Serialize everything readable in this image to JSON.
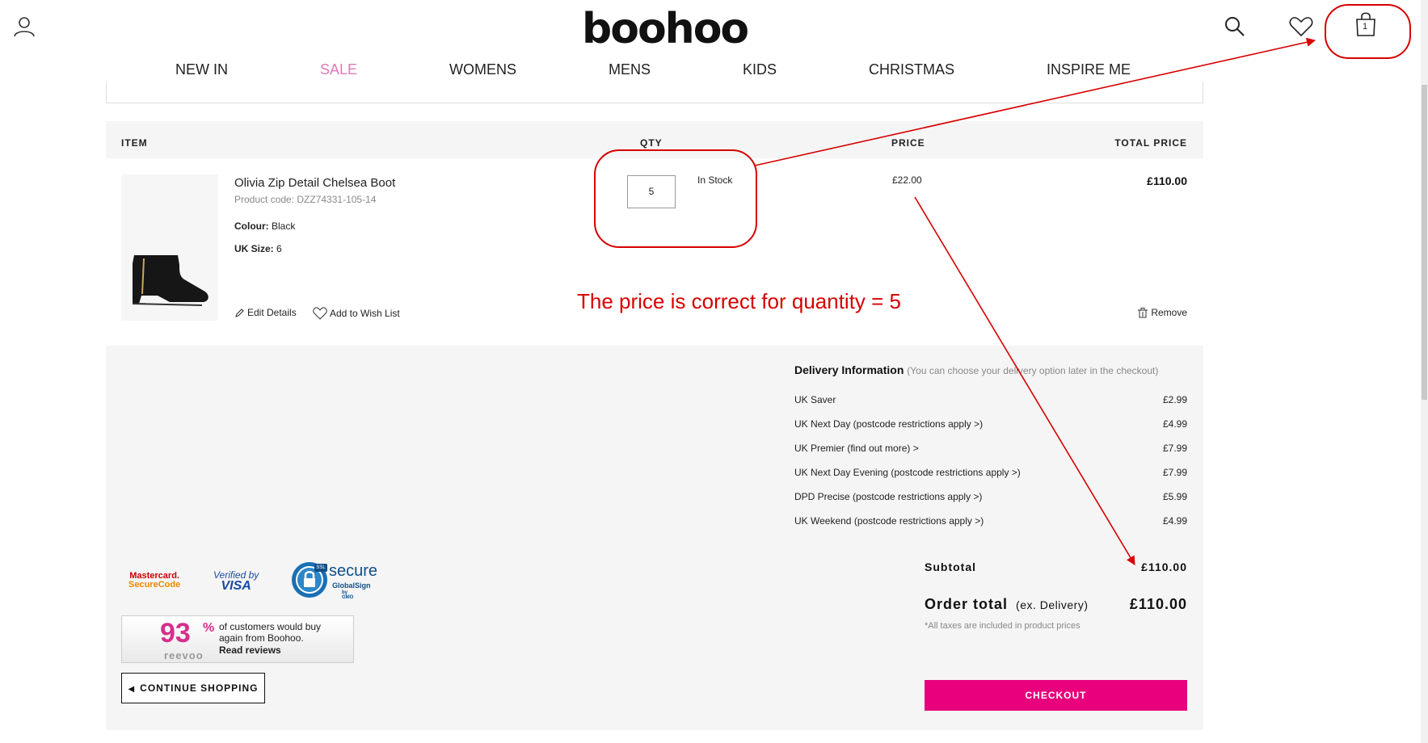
{
  "header": {
    "logo": "boohoo",
    "account_icon": "user-icon",
    "search_icon": "search-icon",
    "wishlist_icon": "heart-icon",
    "bag_icon": "shopping-bag-icon",
    "bag_count": "1"
  },
  "nav": {
    "items": [
      "NEW IN",
      "SALE",
      "WOMENS",
      "MENS",
      "KIDS",
      "CHRISTMAS",
      "INSPIRE ME"
    ]
  },
  "table": {
    "headers": {
      "item": "ITEM",
      "qty": "QTY",
      "price": "PRICE",
      "total": "TOTAL PRICE"
    }
  },
  "product": {
    "name": "Olivia Zip Detail Chelsea Boot",
    "code": "Product code: DZZ74331-105-14",
    "colour_label": "Colour:",
    "colour": "Black",
    "size_label": "UK Size:",
    "size": "6",
    "qty": "5",
    "stock": "In Stock",
    "unit_price": "£22.00",
    "total_price": "£110.00",
    "edit_label": "Edit Details",
    "wishlist_label": "Add to Wish List",
    "remove_label": "Remove"
  },
  "delivery": {
    "title": "Delivery Information",
    "note": "(You can choose your delivery option later in the checkout)",
    "options": [
      {
        "name": "UK Saver",
        "price": "£2.99"
      },
      {
        "name": "UK Next Day (postcode restrictions apply >)",
        "price": "£4.99"
      },
      {
        "name": "UK Premier (find out more) >",
        "price": "£7.99"
      },
      {
        "name": "UK Next Day Evening (postcode restrictions apply >)",
        "price": "£7.99"
      },
      {
        "name": "DPD Precise (postcode restrictions apply >)",
        "price": "£5.99"
      },
      {
        "name": "UK Weekend (postcode restrictions apply >)",
        "price": "£4.99"
      }
    ]
  },
  "totals": {
    "subtotal_label": "Subtotal",
    "subtotal": "£110.00",
    "order_total_label": "Order total",
    "order_total_suffix": "(ex. Delivery)",
    "order_total": "£110.00",
    "tax_note": "*All taxes are included in product prices",
    "checkout_label": "CHECKOUT"
  },
  "trust": {
    "mastercard_l1": "Mastercard.",
    "mastercard_l2": "SecureCode",
    "visa_l1": "Verified by",
    "visa_l2": "VISA",
    "ssl_badge": "SSL",
    "ssl_text": "secure",
    "ssl_sub": "GlobalSign",
    "ssl_sub2": "by GMO",
    "reevoo_percent": "93",
    "reevoo_percent_sign": "%",
    "reevoo_brand": "reevoo",
    "reevoo_text": "of customers would buy again from Boohoo.",
    "reevoo_link": "Read reviews"
  },
  "continue_label": "CONTINUE SHOPPING",
  "annotation": "The price is correct for quantity = 5",
  "colors": {
    "accent": "#e8007d",
    "sale": "#e07ab8",
    "annotation": "#d60000"
  }
}
